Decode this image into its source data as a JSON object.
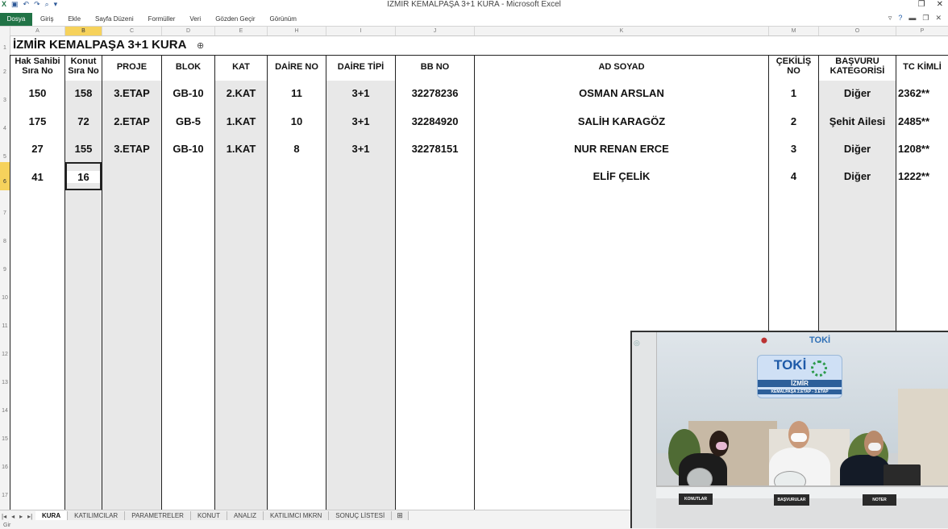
{
  "app": {
    "window_title": "İZMİR KEMALPAŞA 3+1 KURA - Microsoft Excel",
    "file_tab": "Dosya",
    "ribbon_tabs": [
      "Giriş",
      "Ekle",
      "Sayfa Düzeni",
      "Formüller",
      "Veri",
      "Gözden Geçir",
      "Görünüm"
    ]
  },
  "grid": {
    "column_letters": [
      "A",
      "B",
      "C",
      "D",
      "E",
      "H",
      "I",
      "J",
      "K",
      "M",
      "O",
      "P"
    ],
    "row_numbers": [
      "1",
      "2",
      "3",
      "4",
      "5",
      "6",
      "7",
      "8",
      "9",
      "10",
      "11",
      "12",
      "13",
      "14",
      "15",
      "16",
      "17"
    ]
  },
  "sheet": {
    "title": "İZMİR KEMALPAŞA 3+1 KURA",
    "headers": {
      "hak_sahibi": "Hak Sahibi\nSıra No",
      "konut": "Konut\nSıra No",
      "proje": "PROJE",
      "blok": "BLOK",
      "kat": "KAT",
      "daire_no": "DAİRE NO",
      "daire_tipi": "DAİRE TİPİ",
      "bb_no": "BB NO",
      "ad_soyad": "AD SOYAD",
      "cekilis": "ÇEKİLİŞ\nNO",
      "basvuru": "BAŞVURU\nKATEGORİSİ",
      "tc": "TC KİMLİ"
    },
    "rows": [
      {
        "hak": "150",
        "konut": "158",
        "proje": "3.ETAP",
        "blok": "GB-10",
        "kat": "2.KAT",
        "daire_no": "11",
        "tipi": "3+1",
        "bb": "32278236",
        "ad": "OSMAN ARSLAN",
        "cekilis": "1",
        "kategori": "Diğer",
        "tc": "2362**"
      },
      {
        "hak": "175",
        "konut": "72",
        "proje": "2.ETAP",
        "blok": "GB-5",
        "kat": "1.KAT",
        "daire_no": "10",
        "tipi": "3+1",
        "bb": "32284920",
        "ad": "SALİH KARAGÖZ",
        "cekilis": "2",
        "kategori": "Şehit Ailesi",
        "tc": "2485**"
      },
      {
        "hak": "27",
        "konut": "155",
        "proje": "3.ETAP",
        "blok": "GB-10",
        "kat": "1.KAT",
        "daire_no": "8",
        "tipi": "3+1",
        "bb": "32278151",
        "ad": "NUR RENAN ERCE",
        "cekilis": "3",
        "kategori": "Diğer",
        "tc": "1208**"
      },
      {
        "hak": "41",
        "konut": "16",
        "proje": "",
        "blok": "",
        "kat": "",
        "daire_no": "",
        "tipi": "",
        "bb": "",
        "ad": "ELİF ÇELİK",
        "cekilis": "4",
        "kategori": "Diğer",
        "tc": "1222**"
      }
    ]
  },
  "sheet_tabs": [
    "KURA",
    "KATILIMCILAR",
    "PARAMETRELER",
    "KONUT",
    "ANALIZ",
    "KATILIMCI MKRN",
    "SONUÇ LİSTESİ"
  ],
  "status": {
    "text": "Gir"
  },
  "video": {
    "brand": "TOKİ",
    "city": "İZMİR",
    "subtitle": "KEMALPAŞA 2.ETAP - 3.ETAP",
    "plaques": [
      "KONUTLAR",
      "BAŞVURULAR",
      "NOTER"
    ]
  },
  "colors": {
    "excel_green": "#217346",
    "selection": "#f6d25c",
    "toki_blue": "#1e5aa8"
  }
}
